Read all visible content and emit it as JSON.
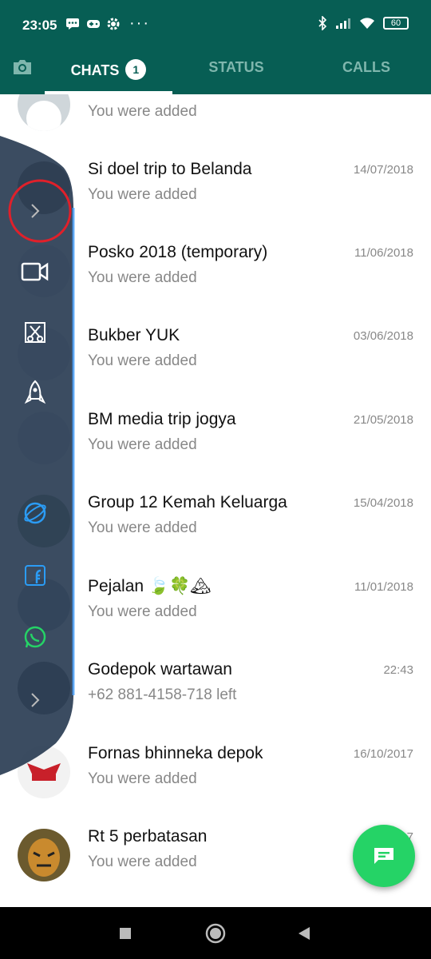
{
  "status_bar": {
    "time": "23:05",
    "notification_icons": [
      "message-icon",
      "game-icon",
      "gear-icon"
    ],
    "more": "···",
    "battery": "60",
    "system_icons": [
      "bluetooth-icon",
      "signal-icon",
      "wifi-icon",
      "battery-icon"
    ]
  },
  "tabs": [
    {
      "label": "CHATS",
      "badge": "1",
      "active": true
    },
    {
      "label": "STATUS",
      "active": false
    },
    {
      "label": "CALLS",
      "active": false
    }
  ],
  "chats": [
    {
      "name": "",
      "message": "You were added",
      "date": ""
    },
    {
      "name": "Si doel trip to Belanda",
      "message": "You were added",
      "date": "14/07/2018"
    },
    {
      "name": "Posko 2018 (temporary)",
      "message": "You were added",
      "date": "11/06/2018"
    },
    {
      "name": "Bukber YUK",
      "message": "You were added",
      "date": "03/06/2018"
    },
    {
      "name": "BM media trip jogya",
      "message": "You were added",
      "date": "21/05/2018"
    },
    {
      "name": "Group 12 Kemah Keluarga",
      "message": "You were added",
      "date": "15/04/2018"
    },
    {
      "name": "Pejalan 🍃🍀🏔",
      "message": "You were added",
      "date": "11/01/2018"
    },
    {
      "name": "Godepok wartawan",
      "message": "+62 881-4158-718 left",
      "date": "22:43"
    },
    {
      "name": "Fornas bhinneka depok",
      "message": "You were added",
      "date": "16/10/2017"
    },
    {
      "name": "Rt 5 perbatasan",
      "message": "You were added",
      "date": "17/0…17"
    }
  ],
  "sidebar": {
    "items": [
      "chevron-right-icon",
      "video-record-icon",
      "screenshot-crop-icon",
      "rocket-icon",
      "browser-icon",
      "facebook-icon",
      "whatsapp-icon",
      "chevron-right-icon"
    ]
  },
  "colors": {
    "header": "#075e54",
    "accent": "#25d366",
    "sidebar": "#2c3e55",
    "highlight_circle": "#e0202a"
  }
}
